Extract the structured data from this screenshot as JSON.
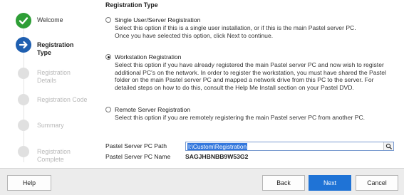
{
  "sidebar": {
    "steps": [
      {
        "label": "Welcome",
        "state": "done"
      },
      {
        "label": "Registration Type",
        "state": "current"
      },
      {
        "label": "Registration Details",
        "state": "pending"
      },
      {
        "label": "Registration Code",
        "state": "pending"
      },
      {
        "label": "Summary",
        "state": "pending"
      },
      {
        "label": "Registration Complete",
        "state": "pending"
      }
    ]
  },
  "main": {
    "title": "Registration Type",
    "options": [
      {
        "label": "Single User/Server Registration",
        "checked": false,
        "description": "Select this option if this is a single user installation, or if this is the main Pastel server PC.\nOnce you have selected this option, click Next to continue."
      },
      {
        "label": "Workstation Registration",
        "checked": true,
        "description": "Select this option if you have already registered the main Pastel server PC and now wish to register\nadditional PC's on the network.  In order to register the workstation, you must have shared the Pastel\nfolder on the main Pastel server PC and mapped a network drive from this PC to the server.  For\ndetailed steps on how to do this, consult the Help Me Install section on your Pastel DVD."
      },
      {
        "label": "Remote Server Registration",
        "checked": false,
        "description": "Select this option if you are remotely registering the main Pastel server PC from another PC."
      }
    ],
    "server_path_label": "Pastel Server PC Path",
    "server_path_value": "I:\\Custom\\Registration",
    "server_name_label": "Pastel Server PC Name",
    "server_name_value": "SAGJHBNBB9W53G2"
  },
  "footer": {
    "help_label": "Help",
    "back_label": "Back",
    "next_label": "Next",
    "cancel_label": "Cancel"
  },
  "colors": {
    "done": "#2e9e36",
    "current": "#1f5fb0",
    "pending": "#e0e0e0",
    "primary_button": "#1f73d6"
  }
}
